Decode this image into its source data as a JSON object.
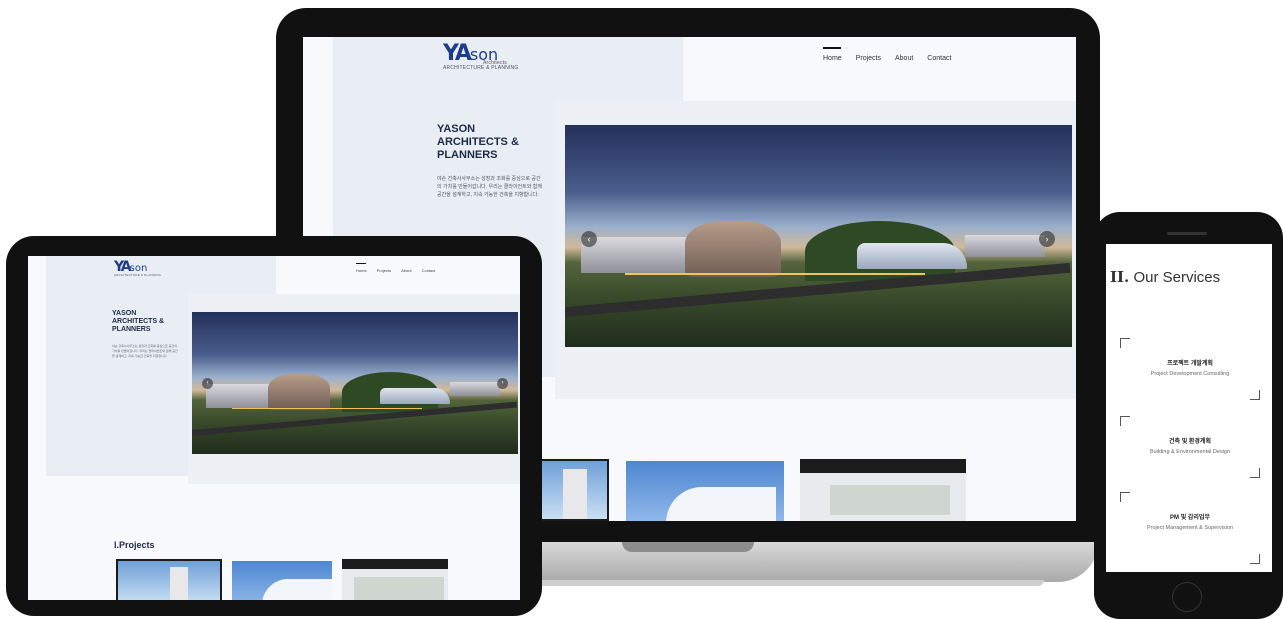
{
  "brand": {
    "logo_mark": "YA",
    "logo_word": "son",
    "logo_sub": "Architects",
    "logo_tagline": "ARCHITECTURE & PLANNING"
  },
  "nav": {
    "items": [
      "Home",
      "Projects",
      "About",
      "Contact"
    ]
  },
  "hero": {
    "headline": "YASON ARCHITECTS & PLANNERS",
    "body": "야손 건축사사무소는 성장과 조화를 중심으로 공간의 가치를 만들어갑니다. 우리는 클라이언트와 함께 공간을 설계하고, 지속 가능한 건축을 지향합니다.",
    "prev_arrow": "‹",
    "next_arrow": "›"
  },
  "projects_section": {
    "title": "Projects",
    "index": "I."
  },
  "services": {
    "index": "II.",
    "title": "Our Services",
    "items": [
      {
        "ko": "프로젝트 개발계획",
        "en": "Project Development Consulting"
      },
      {
        "ko": "건축 및 환경계획",
        "en": "Building & Environmental Design"
      },
      {
        "ko": "PM 및 감리업무",
        "en": "Project Management & Supervision"
      }
    ]
  },
  "colors": {
    "brand_blue": "#1f3c88",
    "panel": "#e9eef5",
    "device_frame": "#111111"
  },
  "icons": [
    "chevron-left-icon",
    "chevron-right-icon"
  ]
}
